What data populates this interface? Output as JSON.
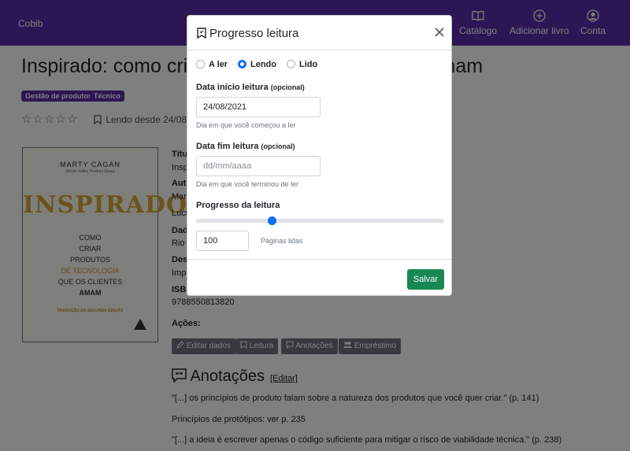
{
  "navbar": {
    "brand": "Cobib",
    "items": [
      {
        "label": "Catálogo",
        "icon": "book-icon"
      },
      {
        "label": "Adicionar livro",
        "icon": "plus-circle-icon"
      },
      {
        "label": "Conta",
        "icon": "user-circle-icon"
      }
    ]
  },
  "book": {
    "title_left": "Inspirado: como criar",
    "title_right": "lientes amam",
    "tags": [
      "Gestão de produtos",
      "Técnico"
    ],
    "rating_stars": 0,
    "rating_max": 5,
    "status": "Lendo desde 24/08/20",
    "cover": {
      "author": "MARTY CAGAN",
      "publisher": "Silicon Valley Product Group",
      "big_title": "INSPIRADO",
      "lines": [
        "COMO",
        "CRIAR",
        "PRODUTOS",
        "DE TECNOLOGIA",
        "QUE OS CLIENTES",
        "AMAM"
      ],
      "translation": "TRADUÇÃO DA SEGUNDA EDIÇÃO"
    },
    "fields": [
      {
        "label": "Títu",
        "value": "Insp"
      },
      {
        "label": "Auto",
        "value": "Mar"
      },
      {
        "label": "",
        "value": "Luci"
      },
      {
        "label": "Dad",
        "value": "Rio"
      },
      {
        "label": "Desc",
        "value": "Impr"
      },
      {
        "label": "ISBN",
        "value": "9788550813820"
      }
    ],
    "actions_label": "Ações:",
    "actions": [
      "Editar dados",
      "Leitura",
      "Anotações",
      "Empréstimo"
    ]
  },
  "annotations": {
    "title": "Anotações",
    "edit": "[Editar]",
    "items": [
      "\"[...] os princípios de produto falam sobre a natureza dos produtos que você quer criar.\" (p. 141)",
      "Princípios de protótipos: ver p. 235",
      "\"[...] a ideia é escrever apenas o código suficiente para mitigar o risco de viabilidade técnica.\" (p. 238)"
    ]
  },
  "modal": {
    "title": "Progresso leitura",
    "radios": [
      {
        "label": "A ler",
        "checked": false
      },
      {
        "label": "Lendo",
        "checked": true
      },
      {
        "label": "Lido",
        "checked": false
      }
    ],
    "start_label": "Data início leitura",
    "start_optional": "(opcional)",
    "start_value": "24/08/2021",
    "start_help": "Dia em que você começou a ler",
    "end_label": "Data fim leitura",
    "end_optional": "(opcional)",
    "end_placeholder": "dd/mm/aaaa",
    "end_help": "Dia em que você terminou de ler",
    "progress_label": "Progresso da leitura",
    "progress_fraction": 0.3,
    "pages_value": "100",
    "pages_label": "Páginas lidas",
    "save": "Salvar"
  },
  "colors": {
    "navbar": "#5b2da8",
    "primary": "#0d6efd",
    "success": "#198754",
    "secondary": "#6c757d"
  }
}
